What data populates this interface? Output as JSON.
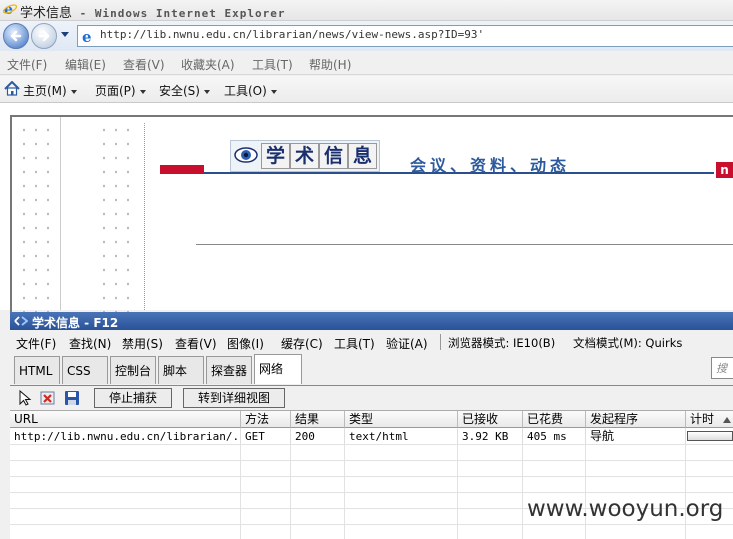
{
  "window": {
    "title": "学术信息",
    "app_name": " - Windows Internet Explorer"
  },
  "address_bar": {
    "url": "http://lib.nwnu.edu.cn/librarian/news/view-news.asp?ID=93'"
  },
  "menubar": {
    "items": [
      "文件(F)",
      "编辑(E)",
      "查看(V)",
      "收藏夹(A)",
      "工具(T)",
      "帮助(H)"
    ]
  },
  "command_bar": {
    "items": [
      "主页(M)",
      "页面(P)",
      "安全(S)",
      "工具(O)"
    ]
  },
  "page": {
    "logo_chars": [
      "学",
      "术",
      "信",
      "息"
    ],
    "tagline": "会议、资料、动态",
    "corner_logo": "n"
  },
  "devtools": {
    "title": "学术信息 - F12",
    "menu": [
      "文件(F)",
      "查找(N)",
      "禁用(S)",
      "查看(V)",
      "图像(I)",
      "缓存(C)",
      "工具(T)",
      "验证(A)",
      "浏览器模式: IE10(B)",
      "文档模式(M): Quirks"
    ],
    "tabs": [
      "HTML",
      "CSS",
      "控制台",
      "脚本",
      "探查器",
      "网络"
    ],
    "active_tab": "网络",
    "search_placeholder": "搜",
    "toolbar": {
      "stop_label": "停止捕获",
      "detail_label": "转到详细视图"
    },
    "network": {
      "columns": [
        "URL",
        "方法",
        "结果",
        "类型",
        "已接收",
        "已花费",
        "发起程序",
        "计时"
      ],
      "rows": [
        [
          "http://lib.nwnu.edu.cn/librarian/...",
          "GET",
          "200",
          "text/html",
          "3.92 KB",
          "405 ms",
          "导航",
          ""
        ]
      ]
    }
  },
  "watermark": "www.wooyun.org"
}
